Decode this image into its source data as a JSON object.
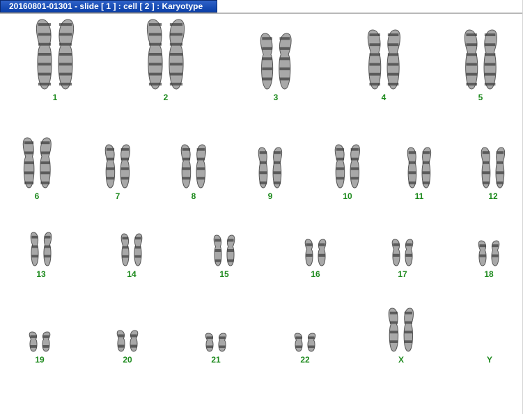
{
  "window": {
    "title": "20160801-01301 - slide [ 1 ] : cell [ 2 ] : Karyotype"
  },
  "karyotype": {
    "chromosomes": [
      {
        "label": "1",
        "copies": 2
      },
      {
        "label": "2",
        "copies": 2
      },
      {
        "label": "3",
        "copies": 2
      },
      {
        "label": "4",
        "copies": 2
      },
      {
        "label": "5",
        "copies": 2
      },
      {
        "label": "6",
        "copies": 2
      },
      {
        "label": "7",
        "copies": 2
      },
      {
        "label": "8",
        "copies": 2
      },
      {
        "label": "9",
        "copies": 2
      },
      {
        "label": "10",
        "copies": 2
      },
      {
        "label": "11",
        "copies": 2
      },
      {
        "label": "12",
        "copies": 2
      },
      {
        "label": "13",
        "copies": 2
      },
      {
        "label": "14",
        "copies": 2
      },
      {
        "label": "15",
        "copies": 2
      },
      {
        "label": "16",
        "copies": 2
      },
      {
        "label": "17",
        "copies": 2
      },
      {
        "label": "18",
        "copies": 2
      },
      {
        "label": "19",
        "copies": 2
      },
      {
        "label": "20",
        "copies": 2
      },
      {
        "label": "21",
        "copies": 2
      },
      {
        "label": "22",
        "copies": 2
      },
      {
        "label": "X",
        "copies": 2
      },
      {
        "label": "Y",
        "copies": 0
      }
    ]
  },
  "colors": {
    "label": "#1d8a1d",
    "titlebar": "#0a3fa8",
    "chromosome": "#3a3a3a"
  }
}
